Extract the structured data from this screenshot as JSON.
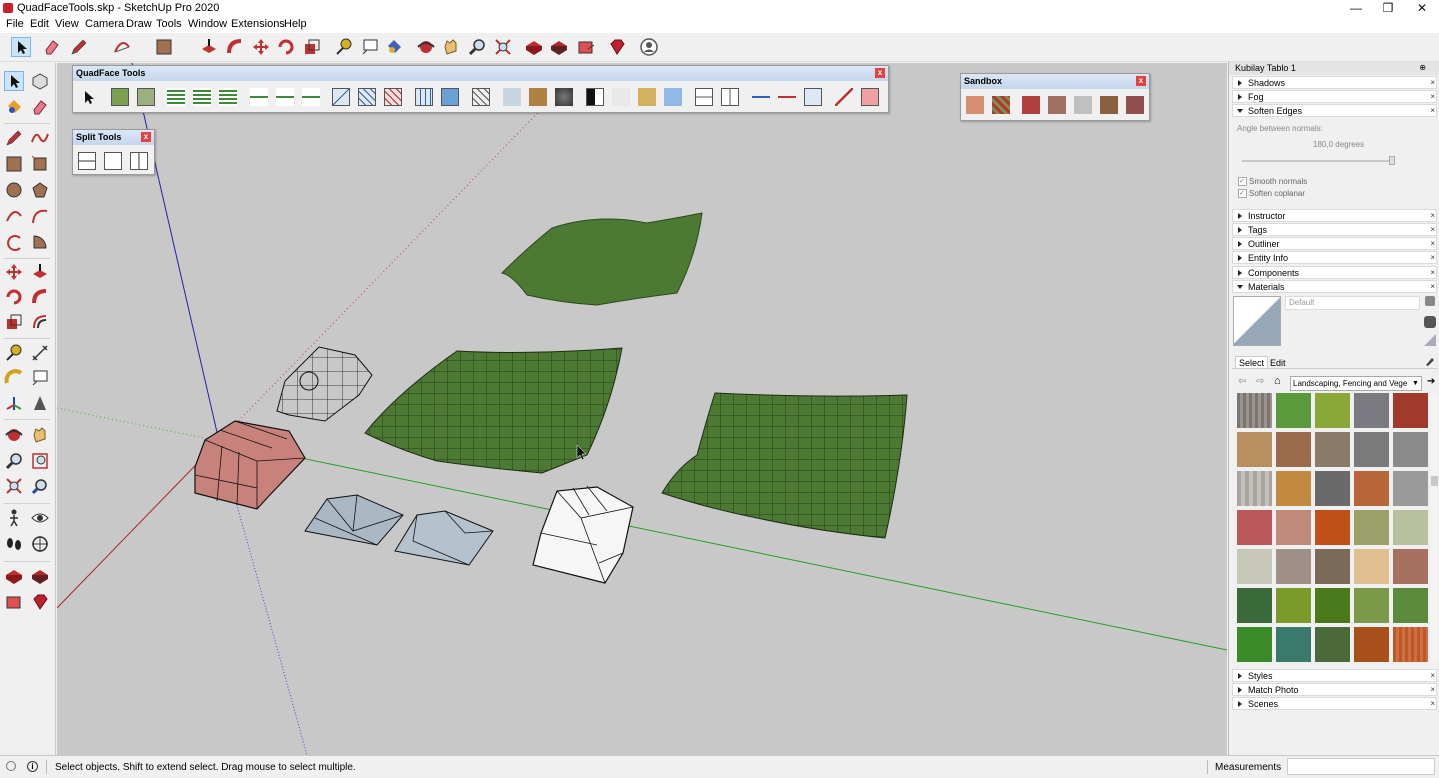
{
  "app": {
    "title": "QuadFaceTools.skp - SketchUp Pro 2020",
    "window_buttons": [
      "—",
      "❐",
      "✕"
    ]
  },
  "menu": [
    "File",
    "Edit",
    "View",
    "Camera",
    "Draw",
    "Tools",
    "Window",
    "Extensions",
    "Help"
  ],
  "toolbars": {
    "quadface": {
      "title": "QuadFace Tools"
    },
    "split": {
      "title": "Split Tools"
    },
    "sandbox": {
      "title": "Sandbox"
    },
    "close": "x"
  },
  "tray": {
    "title": "Kubilay Tablo 1",
    "pin": "⊕",
    "panels_top": [
      "Shadows",
      "Fog"
    ],
    "soften": {
      "label": "Soften Edges",
      "angle_label": "Angle between normals:",
      "angle_value": "180,0  degrees",
      "slider_value": 1.0,
      "smooth_normals": "Smooth normals",
      "soften_coplanar": "Soften coplanar"
    },
    "panels_mid": [
      "Instructor",
      "Tags",
      "Outliner",
      "Entity Info",
      "Components"
    ],
    "materials": {
      "label": "Materials",
      "name": "Default",
      "tab_select": "Select",
      "tab_edit": "Edit",
      "library": "Landscaping, Fencing and Vege"
    },
    "panels_bottom": [
      "Styles",
      "Match Photo",
      "Scenes"
    ]
  },
  "status": {
    "text": "Select objects. Shift to extend select. Drag mouse to select multiple.",
    "measurements": "Measurements"
  },
  "colors": {
    "viewport": "#c8c8c8",
    "green_mesh": "#4c7a33",
    "toolbar_bg": "#f0f0f0"
  }
}
